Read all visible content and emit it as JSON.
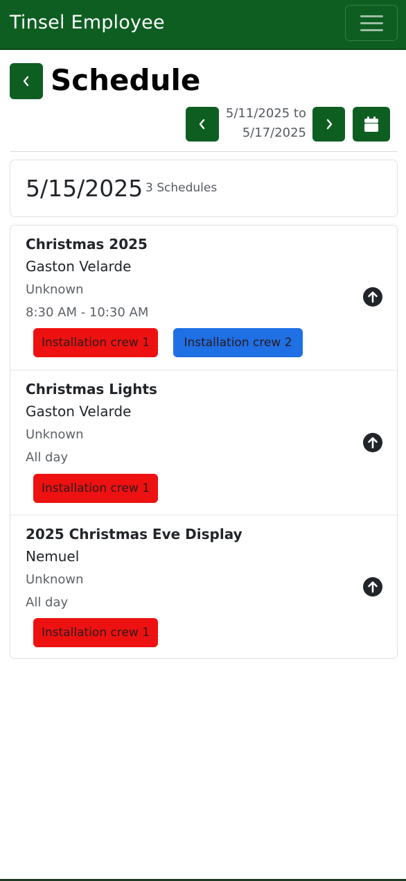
{
  "navbar": {
    "brand": "Tinsel Employee",
    "menu_icon": "hamburger-icon"
  },
  "header": {
    "title": "Schedule",
    "back_icon": "chevron-left-icon",
    "range_start": "5/11/2025 to",
    "range_end": "5/17/2025",
    "prev_icon": "chevron-left-icon",
    "next_icon": "chevron-right-icon",
    "calendar_icon": "calendar-icon"
  },
  "day": {
    "date": "5/15/2025",
    "count": "3 Schedules"
  },
  "schedules": [
    {
      "title": "Christmas 2025",
      "person": "Gaston Velarde",
      "location": "Unknown",
      "time": "8:30 AM - 10:30 AM",
      "crews": [
        {
          "label": "Installation crew 1",
          "color": "#ee1111"
        },
        {
          "label": "Installation crew 2",
          "color": "#1f6fe5"
        }
      ],
      "action_icon": "arrow-up-circle-icon"
    },
    {
      "title": "Christmas Lights",
      "person": "Gaston Velarde",
      "location": "Unknown",
      "time": "All day",
      "crews": [
        {
          "label": "Installation crew 1",
          "color": "#ee1111"
        }
      ],
      "action_icon": "arrow-up-circle-icon"
    },
    {
      "title": "2025 Christmas Eve Display",
      "person": "Nemuel",
      "location": "Unknown",
      "time": "All day",
      "crews": [
        {
          "label": "Installation crew 1",
          "color": "#ee1111"
        }
      ],
      "action_icon": "arrow-up-circle-icon"
    }
  ],
  "colors": {
    "primary": "#0e5e22",
    "crew1": "#ee1111",
    "crew2": "#1f6fe5"
  }
}
